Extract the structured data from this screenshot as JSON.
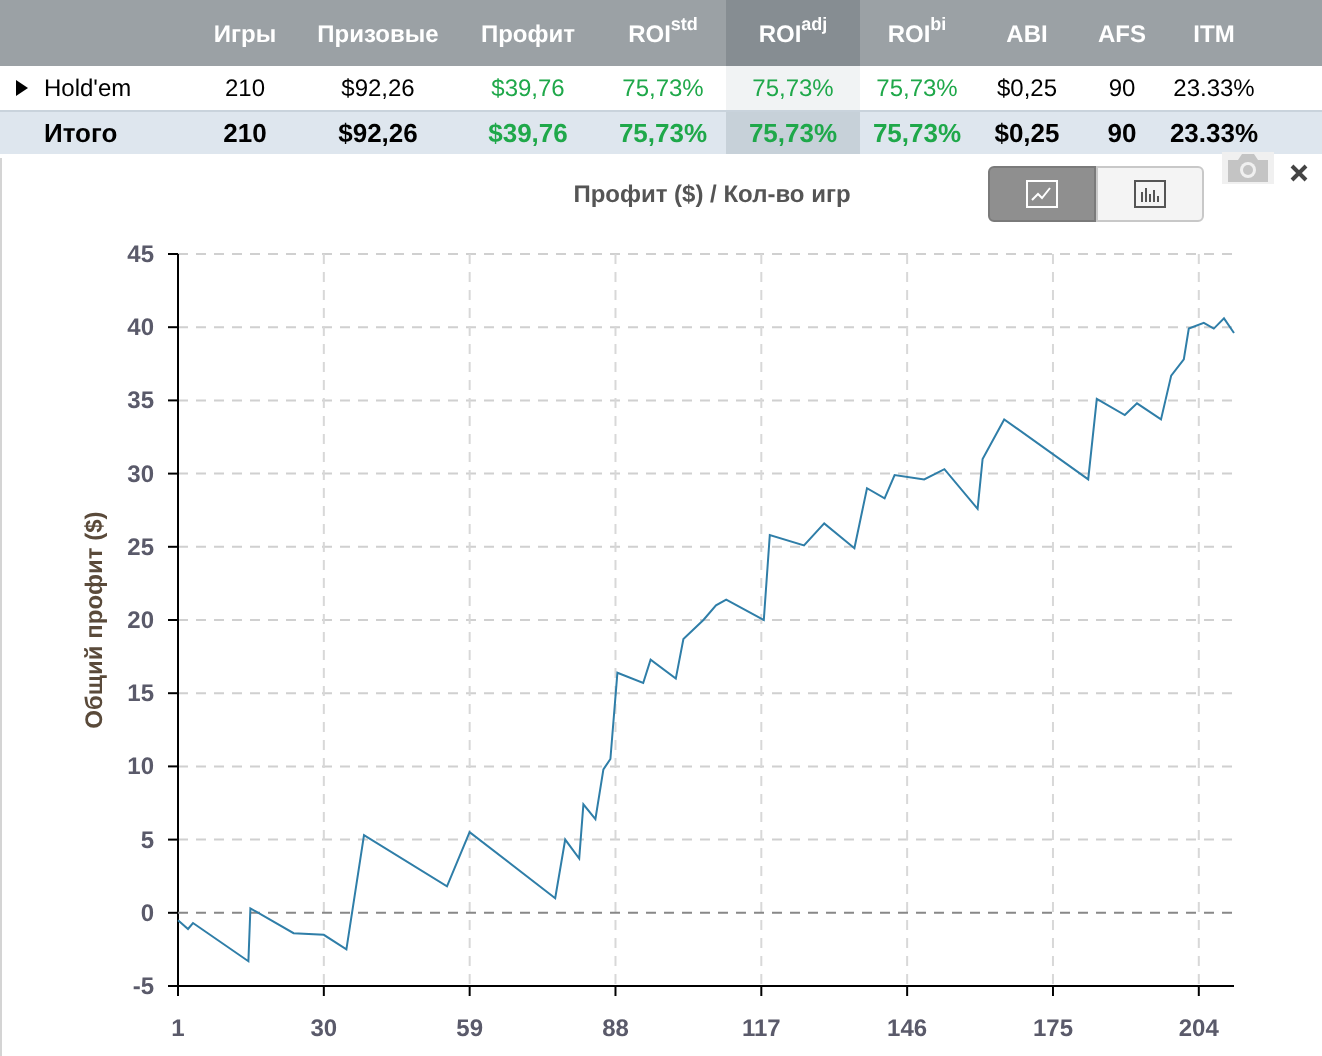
{
  "table": {
    "columns": [
      {
        "selected": false,
        "kind": "name"
      },
      {
        "label": "Игры",
        "selected": false,
        "kind": "plain"
      },
      {
        "label": "Призовые",
        "selected": false,
        "kind": "plain"
      },
      {
        "label": "Профит",
        "selected": false,
        "kind": "gain"
      },
      {
        "label": "ROI$^{std}$",
        "selected": false,
        "kind": "gain"
      },
      {
        "label": "ROI$^{adj}$",
        "selected": true,
        "kind": "gain"
      },
      {
        "label": "ROI$^{bi}$",
        "selected": false,
        "kind": "gain"
      },
      {
        "label": "ABI",
        "selected": false,
        "kind": "plain"
      },
      {
        "label": "AFS",
        "selected": false,
        "kind": "plain"
      },
      {
        "label": "ITM",
        "selected": false,
        "kind": "plain"
      }
    ],
    "rows": [
      {
        "kind": "group",
        "expanded": false,
        "cells": [
          "Hold'em",
          "210",
          "$92,26",
          "$39,76",
          "75,73%",
          "75,73%",
          "75,73%",
          "$0,25",
          "90",
          "23.33%"
        ]
      },
      {
        "kind": "total",
        "cells": [
          "Итого",
          "210",
          "$92,26",
          "$39,76",
          "75,73%",
          "75,73%",
          "75,73%",
          "$0,25",
          "90",
          "23.33%"
        ]
      }
    ]
  },
  "chart_panel": {
    "view_buttons": [
      {
        "kind": "line",
        "selected": true
      },
      {
        "kind": "bar",
        "selected": false
      }
    ],
    "chart_data": {
      "type": "line",
      "title": "Профит ($) / Кол-во игр",
      "ylabel": "Общий профит ($)",
      "xlim": [
        1,
        211
      ],
      "ylim": [
        -5,
        45
      ],
      "grid": true,
      "ref_lines": [
        {
          "axis": "y",
          "value": 0
        }
      ],
      "xticks": [
        1,
        30,
        59,
        88,
        117,
        146,
        175,
        204
      ],
      "yticks": [
        -5,
        0,
        5,
        10,
        15,
        20,
        25,
        30,
        35,
        40,
        45
      ],
      "series": [
        {
          "color": "#2f7ea8",
          "x": [
            1,
            3,
            4,
            15,
            15.4,
            24,
            30,
            34.5,
            38,
            54.5,
            59,
            76,
            78,
            80.8,
            81.6,
            84,
            85.6,
            87,
            88.4,
            93.5,
            95,
            100,
            101.5,
            105.5,
            108,
            110,
            117.5,
            118.7,
            125.5,
            129.5,
            135.5,
            138,
            141.5,
            143.5,
            149.4,
            153.4,
            160,
            161,
            165.3,
            182,
            183.7,
            189.3,
            191.7,
            196.5,
            198.5,
            201,
            202,
            205,
            207,
            209,
            211
          ],
          "values": [
            -0.5,
            -1.1,
            -0.7,
            -3.3,
            0.3,
            -1.4,
            -1.5,
            -2.5,
            5.3,
            1.8,
            5.5,
            1,
            5,
            3.7,
            7.4,
            6.4,
            9.8,
            10.5,
            16.4,
            15.7,
            17.3,
            16,
            18.7,
            20,
            21,
            21.4,
            20,
            25.8,
            25.1,
            26.6,
            24.9,
            29,
            28.3,
            29.9,
            29.6,
            30.3,
            27.6,
            31,
            33.7,
            29.6,
            35.1,
            34,
            34.8,
            33.7,
            36.7,
            37.8,
            39.9,
            40.3,
            39.9,
            40.6,
            39.6
          ]
        }
      ]
    }
  }
}
